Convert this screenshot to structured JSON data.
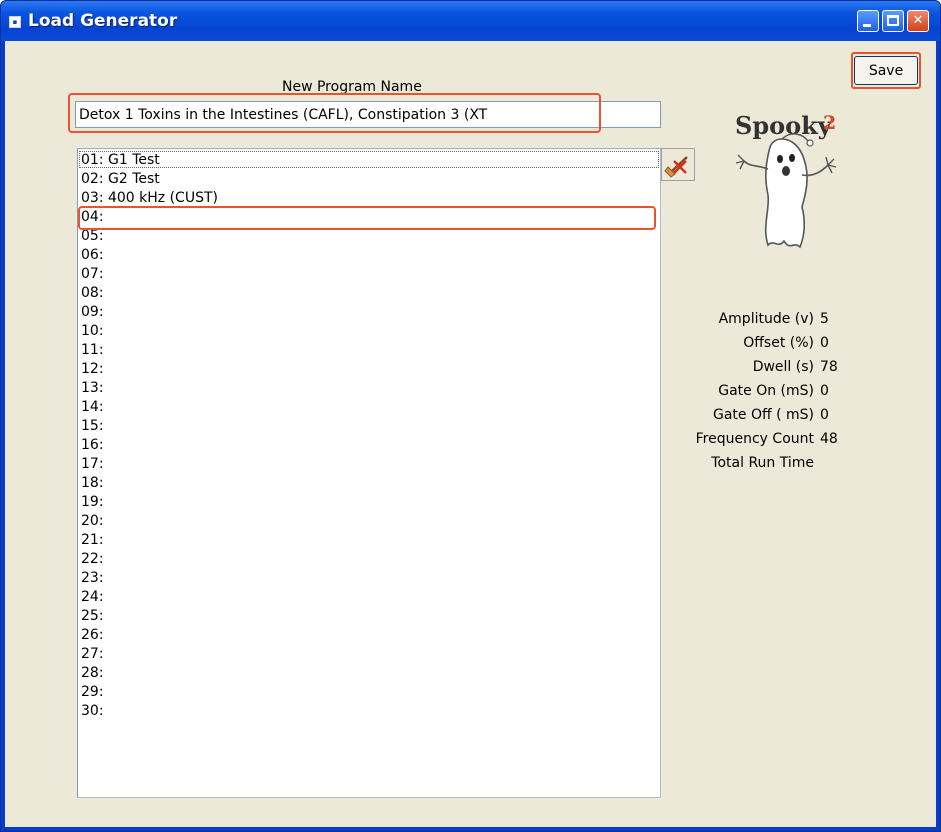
{
  "window": {
    "title": "Load Generator"
  },
  "toolbar": {
    "save_label": "Save"
  },
  "program": {
    "name_label": "New Program Name",
    "name_value": "Detox 1 Toxins in the Intestines (CAFL), Constipation 3 (XT"
  },
  "list": {
    "items": [
      "01: G1 Test",
      "02: G2 Test",
      "03: 400 kHz (CUST)",
      "04:",
      "05:",
      "06:",
      "07:",
      "08:",
      "09:",
      "10:",
      "11:",
      "12:",
      "13:",
      "14:",
      "15:",
      "16:",
      "17:",
      "18:",
      "19:",
      "20:",
      "21:",
      "22:",
      "23:",
      "24:",
      "25:",
      "26:",
      "27:",
      "28:",
      "29:",
      "30:"
    ]
  },
  "logo": {
    "text": "Spooky",
    "superscript": "2"
  },
  "params": {
    "amplitude_label": "Amplitude (v)",
    "amplitude_value": "5",
    "offset_label": "Offset (%)",
    "offset_value": "0",
    "dwell_label": "Dwell (s)",
    "dwell_value": "78",
    "gate_on_label": "Gate On (mS)",
    "gate_on_value": "0",
    "gate_off_label": "Gate Off ( mS)",
    "gate_off_value": "0",
    "freq_count_label": "Frequency Count",
    "freq_count_value": "48",
    "total_run_label": "Total Run Time",
    "total_run_value": ""
  },
  "colors": {
    "highlight": "#e8542e",
    "titlebar": "#0a55e0",
    "client_bg": "#ece9d8"
  },
  "icons": {
    "clear": "clear-broom-icon",
    "app": "app-icon"
  }
}
